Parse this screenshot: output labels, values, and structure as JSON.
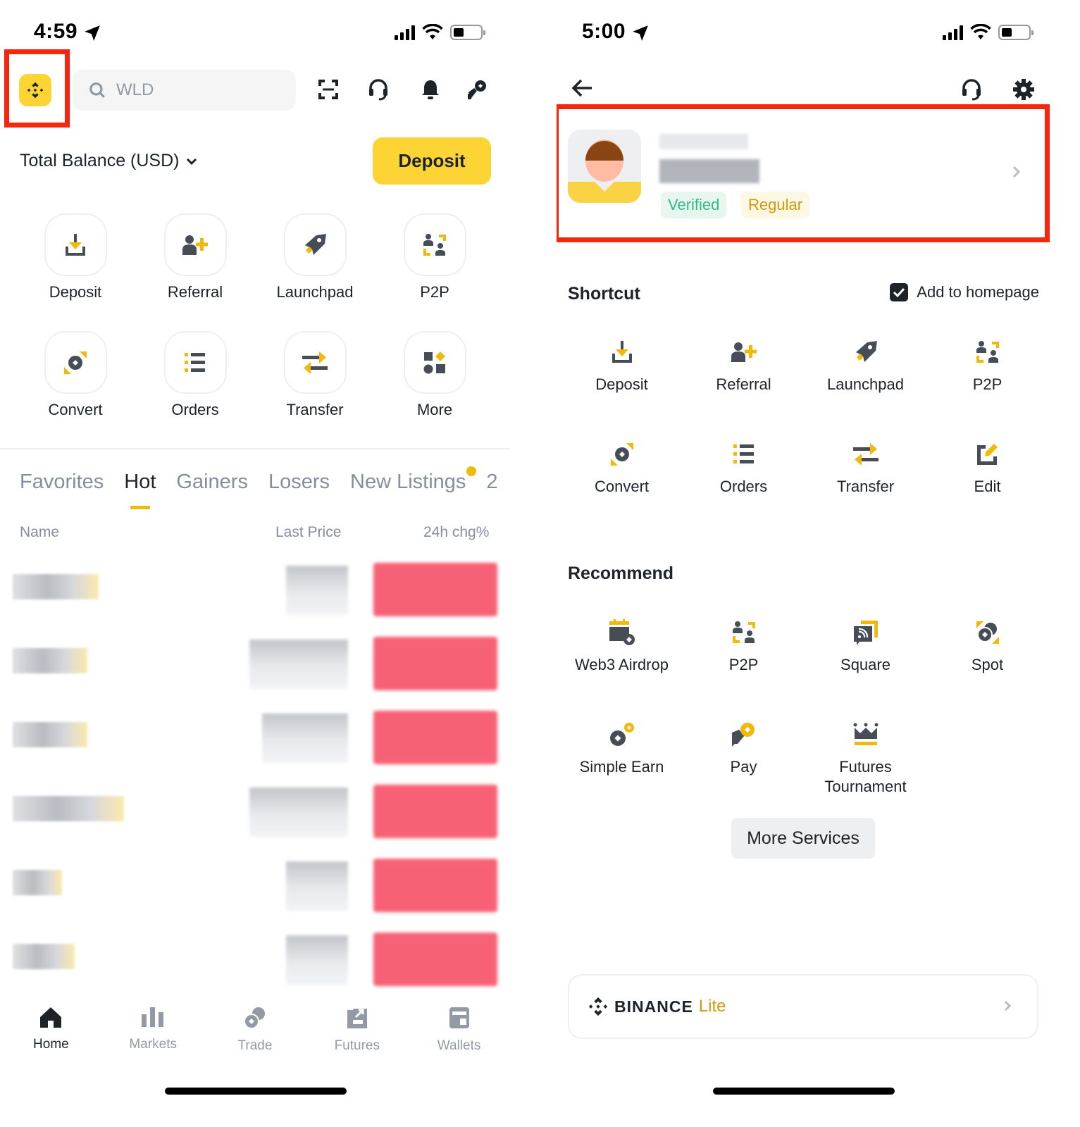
{
  "left_screen": {
    "status_bar": {
      "time": "4:59"
    },
    "header": {
      "logo": "binance-logo",
      "search_placeholder": "WLD",
      "icons": [
        "scan-icon",
        "support-headset-icon",
        "bell-icon",
        "referral-gift-icon"
      ]
    },
    "balance": {
      "label": "Total Balance (USD)",
      "deposit_button": "Deposit"
    },
    "shortcuts": [
      {
        "label": "Deposit",
        "icon": "deposit-icon"
      },
      {
        "label": "Referral",
        "icon": "referral-icon"
      },
      {
        "label": "Launchpad",
        "icon": "launchpad-icon"
      },
      {
        "label": "P2P",
        "icon": "p2p-icon"
      },
      {
        "label": "Convert",
        "icon": "convert-icon"
      },
      {
        "label": "Orders",
        "icon": "orders-icon"
      },
      {
        "label": "Transfer",
        "icon": "transfer-icon"
      },
      {
        "label": "More",
        "icon": "more-icon"
      }
    ],
    "market_tabs": [
      {
        "label": "Favorites",
        "active": false
      },
      {
        "label": "Hot",
        "active": true
      },
      {
        "label": "Gainers",
        "active": false
      },
      {
        "label": "Losers",
        "active": false
      },
      {
        "label": "New Listings",
        "active": false,
        "dot": true
      },
      {
        "label": "2",
        "active": false
      }
    ],
    "columns": {
      "name": "Name",
      "last_price": "Last Price",
      "change": "24h chg%"
    },
    "rows_note": "6 rows, values pixelated/obscured; change badges red (negative)",
    "rows": [
      {
        "name_width": 122,
        "price_width": 88
      },
      {
        "name_width": 106,
        "price_width": 140
      },
      {
        "name_width": 106,
        "price_width": 122
      },
      {
        "name_width": 158,
        "price_width": 140
      },
      {
        "name_width": 70,
        "price_width": 88
      },
      {
        "name_width": 88,
        "price_width": 88
      }
    ],
    "bottom_nav": [
      {
        "label": "Home",
        "icon": "home-icon",
        "active": true
      },
      {
        "label": "Markets",
        "icon": "markets-bar-icon",
        "active": false
      },
      {
        "label": "Trade",
        "icon": "trade-coins-icon",
        "active": false
      },
      {
        "label": "Futures",
        "icon": "futures-icon",
        "active": false
      },
      {
        "label": "Wallets",
        "icon": "wallet-icon",
        "active": false
      }
    ]
  },
  "right_screen": {
    "status_bar": {
      "time": "5:00"
    },
    "profile": {
      "badges": {
        "verified": "Verified",
        "regular": "Regular"
      }
    },
    "shortcut_section": {
      "title": "Shortcut",
      "add_to_homepage": "Add to homepage",
      "add_to_homepage_checked": true,
      "items": [
        {
          "label": "Deposit",
          "icon": "deposit-icon"
        },
        {
          "label": "Referral",
          "icon": "referral-icon"
        },
        {
          "label": "Launchpad",
          "icon": "launchpad-icon"
        },
        {
          "label": "P2P",
          "icon": "p2p-icon"
        },
        {
          "label": "Convert",
          "icon": "convert-icon"
        },
        {
          "label": "Orders",
          "icon": "orders-icon"
        },
        {
          "label": "Transfer",
          "icon": "transfer-icon"
        },
        {
          "label": "Edit",
          "icon": "edit-icon"
        }
      ]
    },
    "recommend_section": {
      "title": "Recommend",
      "items": [
        {
          "label": "Web3 Airdrop",
          "icon": "web3-airdrop-icon"
        },
        {
          "label": "P2P",
          "icon": "p2p-icon"
        },
        {
          "label": "Square",
          "icon": "square-icon"
        },
        {
          "label": "Spot",
          "icon": "spot-icon"
        },
        {
          "label": "Simple Earn",
          "icon": "simple-earn-icon"
        },
        {
          "label": "Pay",
          "icon": "pay-icon"
        },
        {
          "label": "Futures Tournament",
          "icon": "futures-tournament-icon"
        }
      ]
    },
    "more_services": "More Services",
    "lite_card": {
      "brand": "BINANCE",
      "suffix": "Lite"
    }
  },
  "colors": {
    "brand_yellow": "#fcd535",
    "accent_gold": "#f0b90b",
    "text_primary": "#1e2329",
    "text_secondary": "#848e9c",
    "negative_red": "#f6465d",
    "verified_green": "#2ebd85",
    "highlight_red": "#f7250c"
  }
}
